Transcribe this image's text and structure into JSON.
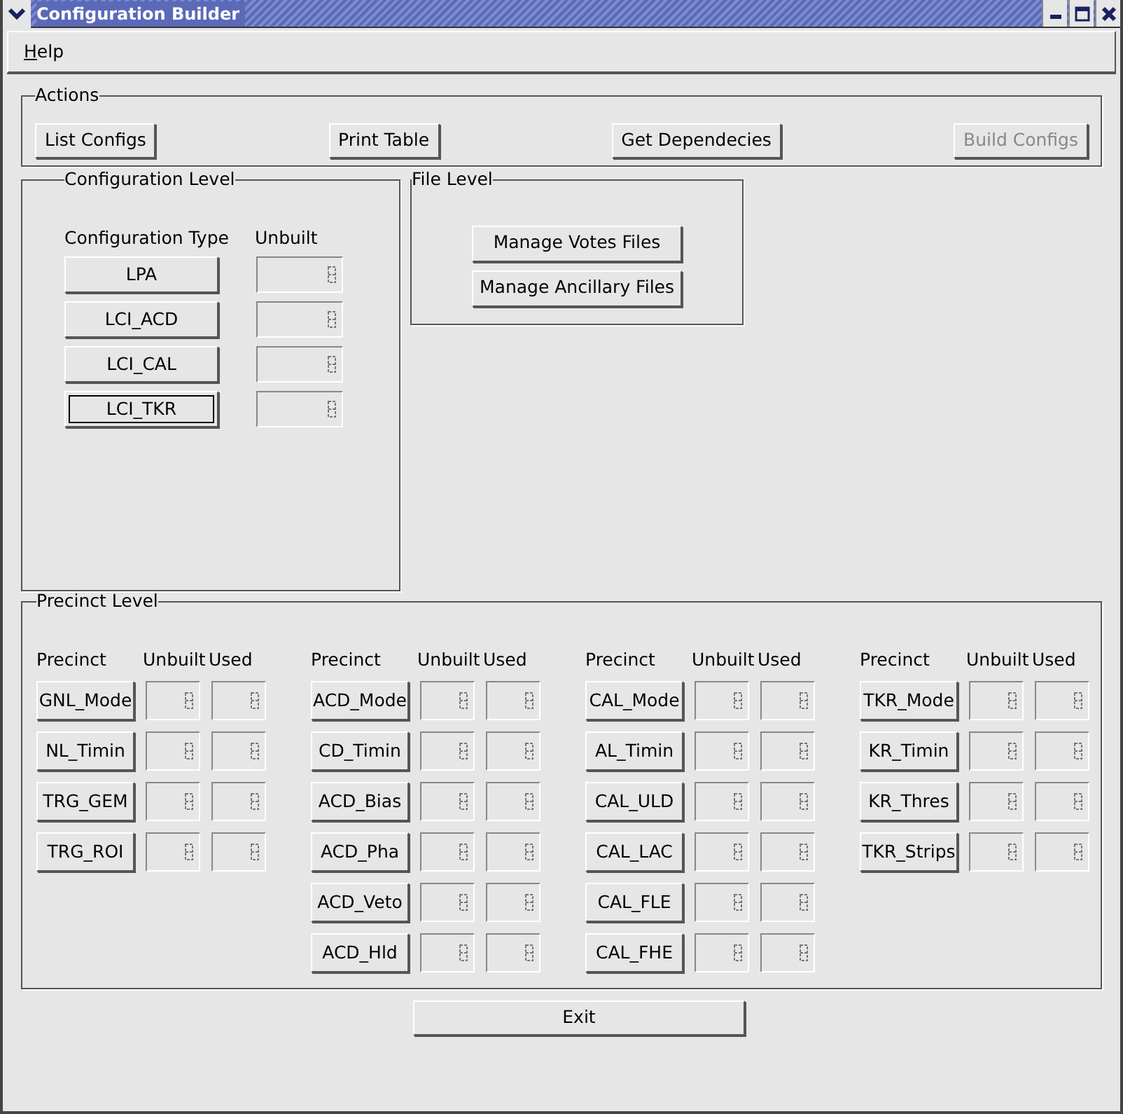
{
  "window": {
    "title": "Configuration Builder"
  },
  "menu": [
    {
      "label": "Help"
    }
  ],
  "actions": {
    "title": "Actions",
    "buttons": [
      {
        "label": "List Configs",
        "disabled": false
      },
      {
        "label": "Print Table",
        "disabled": false
      },
      {
        "label": "Get Dependecies",
        "disabled": false
      },
      {
        "label": "Build Configs",
        "disabled": true
      }
    ]
  },
  "configuration_level": {
    "title": "Configuration Level",
    "headers": [
      "Configuration Type",
      "Unbuilt"
    ],
    "rows": [
      {
        "label": "LPA",
        "focused": false
      },
      {
        "label": "LCI_ACD",
        "focused": false
      },
      {
        "label": "LCI_CAL",
        "focused": false
      },
      {
        "label": "LCI_TKR",
        "focused": true
      }
    ]
  },
  "file_level": {
    "title": "File Level",
    "buttons": [
      "Manage Votes Files",
      "Manage Ancillary Files"
    ]
  },
  "precinct_level": {
    "title": "Precinct Level",
    "groups": [
      {
        "headers": [
          "Precinct",
          "Unbuilt",
          "Used"
        ],
        "rows": [
          "GNL_Mode",
          "NL_Timin",
          "TRG_GEM",
          "TRG_ROI"
        ]
      },
      {
        "headers": [
          "Precinct",
          "Unbuilt",
          "Used"
        ],
        "rows": [
          "ACD_Mode",
          "CD_Timin",
          "ACD_Bias",
          "ACD_Pha",
          "ACD_Veto",
          "ACD_Hld"
        ]
      },
      {
        "headers": [
          "Precinct",
          "Unbuilt",
          "Used"
        ],
        "rows": [
          "CAL_Mode",
          "AL_Timin",
          "CAL_ULD",
          "CAL_LAC",
          "CAL_FLE",
          "CAL_FHE"
        ]
      },
      {
        "headers": [
          "Precinct",
          "Unbuilt",
          "Used"
        ],
        "rows": [
          "TKR_Mode",
          "KR_Timin",
          "KR_Thres",
          "TKR_Strips"
        ]
      }
    ]
  },
  "exit_button": "Exit"
}
